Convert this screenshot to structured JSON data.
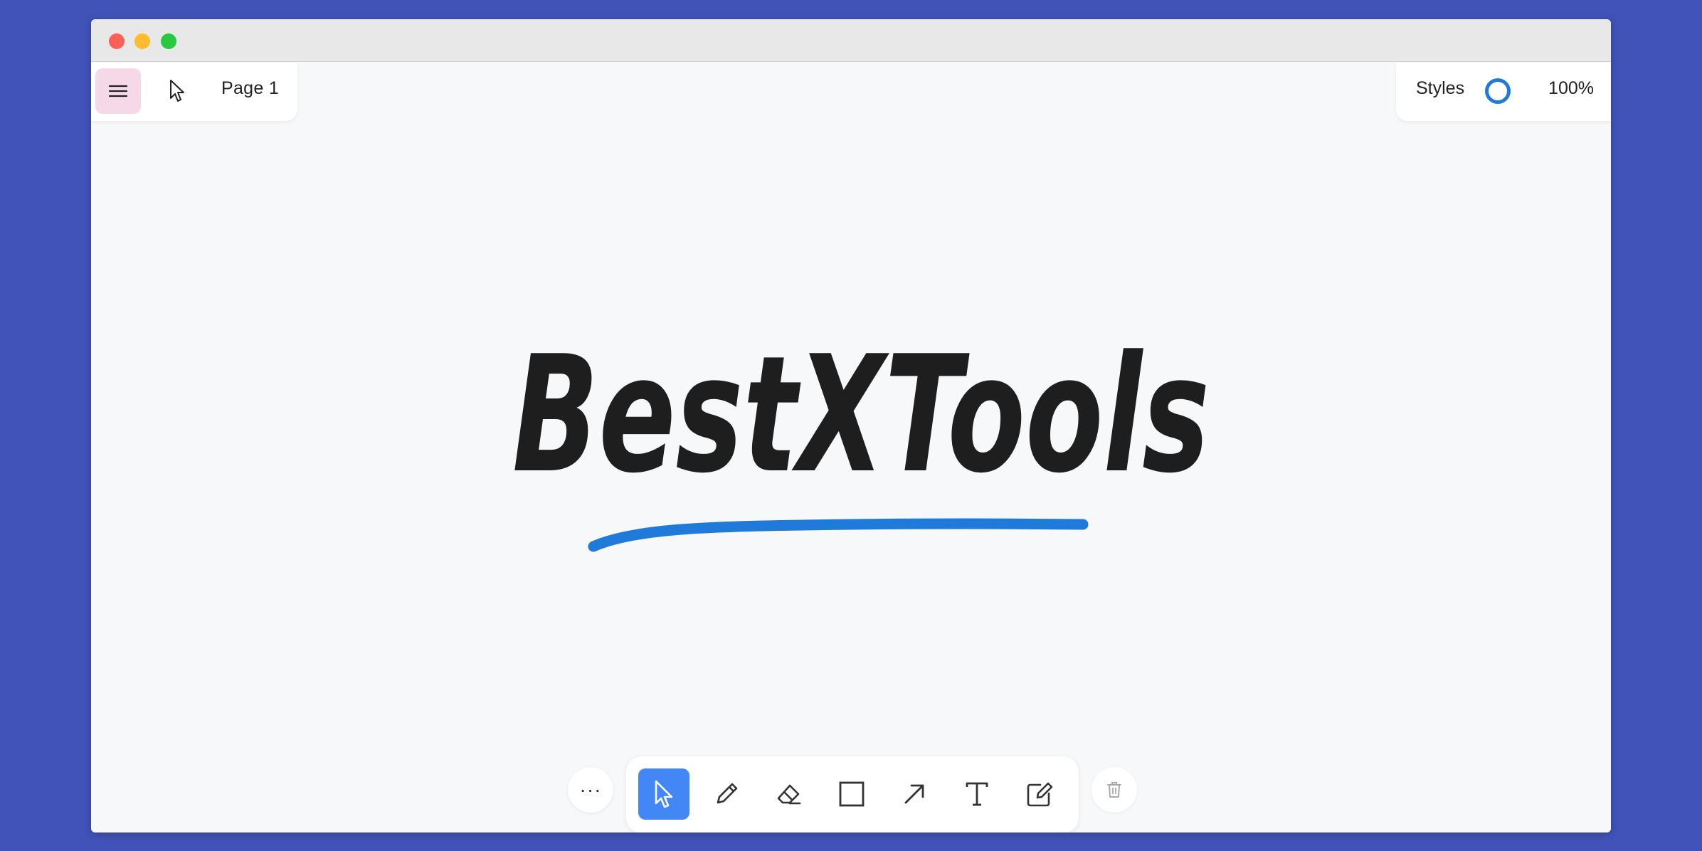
{
  "window": {
    "close_color": "#fe5f57",
    "minimize_color": "#febc2e",
    "maximize_color": "#28c840"
  },
  "top_left": {
    "menu_icon": "hamburger-icon",
    "cursor_icon": "cursor-icon",
    "page_label": "Page 1"
  },
  "top_right": {
    "styles_label": "Styles",
    "style_color": "#1f7ad9",
    "zoom_label": "100%"
  },
  "canvas": {
    "drawn_text": "BestXTools",
    "underline_color": "#1f7ad9",
    "ink_color": "#1e1e1e"
  },
  "toolbar": {
    "more_label": "···",
    "tools": [
      {
        "name": "select",
        "icon": "select-arrow-icon",
        "active": true
      },
      {
        "name": "draw",
        "icon": "pencil-icon",
        "active": false
      },
      {
        "name": "eraser",
        "icon": "eraser-icon",
        "active": false
      },
      {
        "name": "rectangle",
        "icon": "rectangle-icon",
        "active": false
      },
      {
        "name": "arrow",
        "icon": "arrow-icon",
        "active": false
      },
      {
        "name": "text",
        "icon": "text-icon",
        "active": false
      },
      {
        "name": "note",
        "icon": "note-edit-icon",
        "active": false
      }
    ],
    "trash_icon": "trash-icon",
    "active_color": "#4387f6"
  }
}
